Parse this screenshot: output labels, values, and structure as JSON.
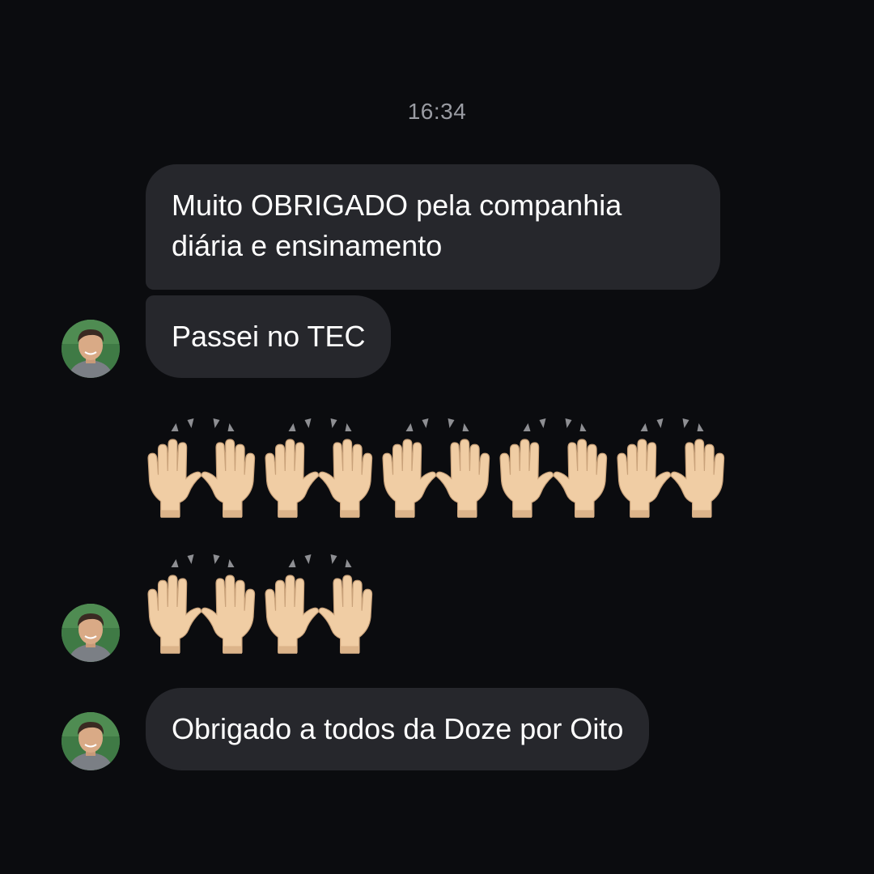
{
  "conversation": {
    "timestamp": "16:34",
    "messages": [
      {
        "type": "text",
        "text": "Muito OBRIGADO pela companhia diária e ensinamento"
      },
      {
        "type": "text",
        "text": "Passei no TEC"
      },
      {
        "type": "emoji",
        "emoji": "raising-hands-icon",
        "count_row1": 5,
        "count_row2": 2
      },
      {
        "type": "text",
        "text": "Obrigado a todos da Doze por Oito"
      }
    ]
  },
  "colors": {
    "background": "#0b0c0f",
    "bubble": "#26272c",
    "timestamp": "#9a9ca3",
    "text": "#ffffff"
  }
}
